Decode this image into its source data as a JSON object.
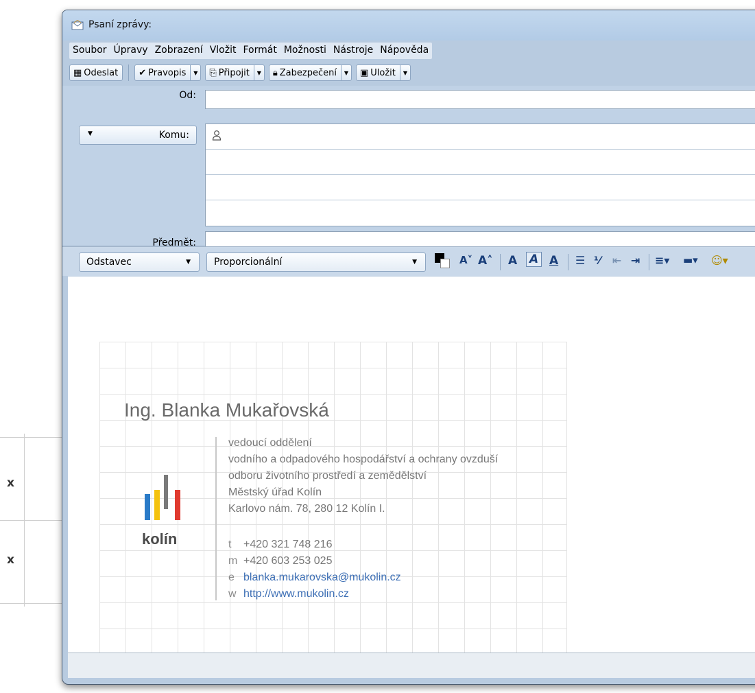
{
  "guides": {
    "mark1": "x",
    "mark2": "x"
  },
  "window": {
    "title": "Psaní zprávy:"
  },
  "menu": [
    "Soubor",
    "Úpravy",
    "Zobrazení",
    "Vložit",
    "Formát",
    "Možnosti",
    "Nástroje",
    "Nápověda"
  ],
  "toolbar": {
    "send": "Odeslat",
    "spell": "Pravopis",
    "attach": "Připojit",
    "security": "Zabezpečení",
    "save": "Uložit"
  },
  "headers": {
    "from_label": "Od:",
    "to_label": "Komu:",
    "subject_label": "Předmět:"
  },
  "format": {
    "paragraph": "Odstavec",
    "font": "Proporcionální"
  },
  "signature": {
    "name": "Ing. Blanka Mukařovská",
    "title_lines": [
      "vedoucí oddělení",
      "vodního a odpadového hospodářství a ochrany ovzduší",
      "odboru životního prostředí a zemědělství",
      "Městský úřad Kolín",
      "Karlovo nám. 78,  280 12 Kolín I."
    ],
    "contacts": [
      {
        "key": "t",
        "value": "+420 321 748 216"
      },
      {
        "key": "m",
        "value": "+420 603 253 025"
      },
      {
        "key": "e",
        "value": "blanka.mukarovska@mukolin.cz"
      },
      {
        "key": "w",
        "value": "http://www.mukolin.cz"
      }
    ],
    "logo_text": "kolín",
    "logo_colors": [
      "#2a7bc8",
      "#f4c20d",
      "#7a7a7a",
      "#e03a2f"
    ]
  }
}
